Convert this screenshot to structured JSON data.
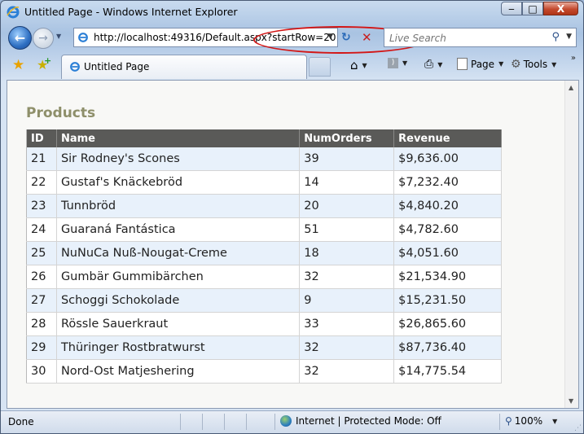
{
  "window": {
    "title": "Untitled Page - Windows Internet Explorer",
    "close_glyph": "X",
    "maximize_glyph": "□",
    "minimize_glyph": "‒"
  },
  "nav": {
    "address": "http://localhost:49316/Default.aspx?startRow=20",
    "search_placeholder": "Live Search"
  },
  "tabs": [
    {
      "label": "Untitled Page"
    }
  ],
  "commands": {
    "page": "Page",
    "tools": "Tools"
  },
  "page": {
    "title": "Products",
    "columns": [
      "ID",
      "Name",
      "NumOrders",
      "Revenue"
    ],
    "rows": [
      [
        "21",
        "Sir Rodney's Scones",
        "39",
        "$9,636.00"
      ],
      [
        "22",
        "Gustaf's Knäckebröd",
        "14",
        "$7,232.40"
      ],
      [
        "23",
        "Tunnbröd",
        "20",
        "$4,840.20"
      ],
      [
        "24",
        "Guaraná Fantástica",
        "51",
        "$4,782.60"
      ],
      [
        "25",
        "NuNuCa Nuß-Nougat-Creme",
        "18",
        "$4,051.60"
      ],
      [
        "26",
        "Gumbär Gummibärchen",
        "32",
        "$21,534.90"
      ],
      [
        "27",
        "Schoggi Schokolade",
        "9",
        "$15,231.50"
      ],
      [
        "28",
        "Rössle Sauerkraut",
        "33",
        "$26,865.60"
      ],
      [
        "29",
        "Thüringer Rostbratwurst",
        "32",
        "$87,736.40"
      ],
      [
        "30",
        "Nord-Ost Matjeshering",
        "32",
        "$14,775.54"
      ]
    ]
  },
  "status": {
    "text": "Done",
    "zone": "Internet | Protected Mode: Off",
    "zoom": "100%"
  },
  "colors": {
    "header_bg": "#5a5a58",
    "alt_row_bg": "#e8f1fb",
    "title_color": "#8e8f6a",
    "annotation_circle": "#d31616"
  }
}
